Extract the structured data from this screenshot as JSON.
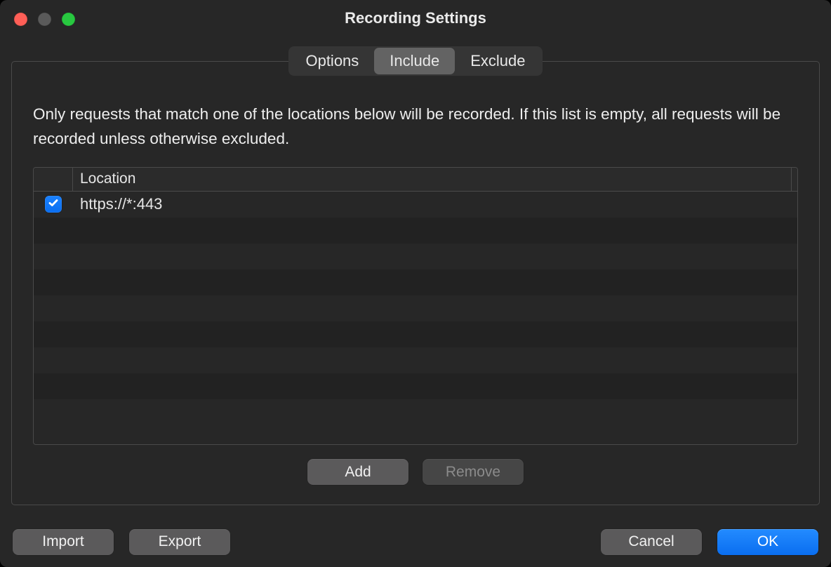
{
  "window": {
    "title": "Recording Settings"
  },
  "tabs": {
    "options": "Options",
    "include": "Include",
    "exclude": "Exclude",
    "active": "include"
  },
  "panel": {
    "description": "Only requests that match one of the locations below will be recorded. If this list is empty, all requests will be recorded unless otherwise excluded.",
    "columns": {
      "location": "Location"
    },
    "rows": [
      {
        "enabled": true,
        "location": "https://*:443"
      }
    ],
    "buttons": {
      "add": "Add",
      "remove": "Remove"
    }
  },
  "footer": {
    "import": "Import",
    "export": "Export",
    "cancel": "Cancel",
    "ok": "OK"
  }
}
